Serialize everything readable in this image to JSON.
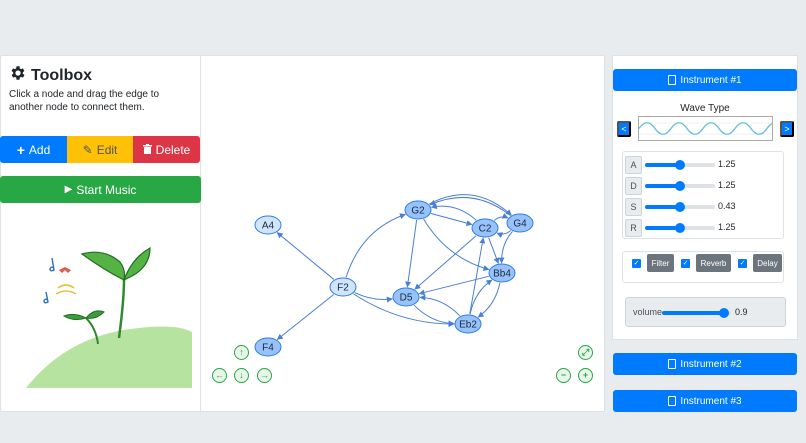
{
  "toolbox": {
    "title": "Toolbox",
    "description": "Click a node and drag the edge to another node to connect them."
  },
  "actions": {
    "add_label": "Add",
    "edit_label": "Edit",
    "delete_label": "Delete",
    "start_label": "Start Music",
    "add_color": "#007bff",
    "edit_color": "#ffc107",
    "delete_color": "#dc3545",
    "start_color": "#28a745"
  },
  "graph": {
    "nodes": [
      {
        "id": "A4",
        "label": "A4",
        "selected": false
      },
      {
        "id": "G2",
        "label": "G2",
        "selected": true
      },
      {
        "id": "C2",
        "label": "C2",
        "selected": true
      },
      {
        "id": "G4",
        "label": "G4",
        "selected": true
      },
      {
        "id": "F2",
        "label": "F2",
        "selected": false
      },
      {
        "id": "D5",
        "label": "D5",
        "selected": true
      },
      {
        "id": "Bb4",
        "label": "Bb4",
        "selected": true
      },
      {
        "id": "Eb2",
        "label": "Eb2",
        "selected": true
      },
      {
        "id": "F4",
        "label": "F4",
        "selected": true
      }
    ],
    "edges": [
      [
        "F2",
        "A4"
      ],
      [
        "F2",
        "F4"
      ],
      [
        "F2",
        "G2"
      ],
      [
        "F2",
        "D5"
      ],
      [
        "F2",
        "Eb2"
      ],
      [
        "G2",
        "D5"
      ],
      [
        "G2",
        "C2"
      ],
      [
        "G2",
        "G4"
      ],
      [
        "G2",
        "Bb4"
      ],
      [
        "C2",
        "G2"
      ],
      [
        "C2",
        "D5"
      ],
      [
        "C2",
        "Bb4"
      ],
      [
        "C2",
        "G4"
      ],
      [
        "G4",
        "C2"
      ],
      [
        "G4",
        "Bb4"
      ],
      [
        "G4",
        "G2"
      ],
      [
        "Bb4",
        "Eb2"
      ],
      [
        "Bb4",
        "D5"
      ],
      [
        "Eb2",
        "Bb4"
      ],
      [
        "Eb2",
        "D5"
      ],
      [
        "Eb2",
        "C2"
      ],
      [
        "D5",
        "Eb2"
      ]
    ],
    "node_color": "#97c2fc",
    "node_border": "#2b7ce9",
    "edge_color": "#4a7fd4"
  },
  "navigation": {
    "up": "up-arrow-icon",
    "left": "left-arrow-icon",
    "down": "down-arrow-icon",
    "right": "right-arrow-icon",
    "fit": "fit-icon",
    "zoom_out": "zoom-out-icon",
    "zoom_in": "zoom-in-icon"
  },
  "instruments": [
    {
      "label": "Instrument #1"
    },
    {
      "label": "Instrument #2"
    },
    {
      "label": "Instrument #3"
    }
  ],
  "synth": {
    "wave_type_label": "Wave Type",
    "prev_label": "<",
    "next_label": ">",
    "adsr": [
      {
        "label": "A",
        "value": "1.25",
        "fraction": 0.5
      },
      {
        "label": "D",
        "value": "1.25",
        "fraction": 0.5
      },
      {
        "label": "S",
        "value": "0.43",
        "fraction": 0.5
      },
      {
        "label": "R",
        "value": "1.25",
        "fraction": 0.5
      }
    ],
    "effects": [
      {
        "label": "Filter",
        "checked": true
      },
      {
        "label": "Reverb",
        "checked": true
      },
      {
        "label": "Delay",
        "checked": true
      }
    ],
    "volume_label": "volume",
    "volume_value": "0.9",
    "volume_fraction": 0.9
  }
}
